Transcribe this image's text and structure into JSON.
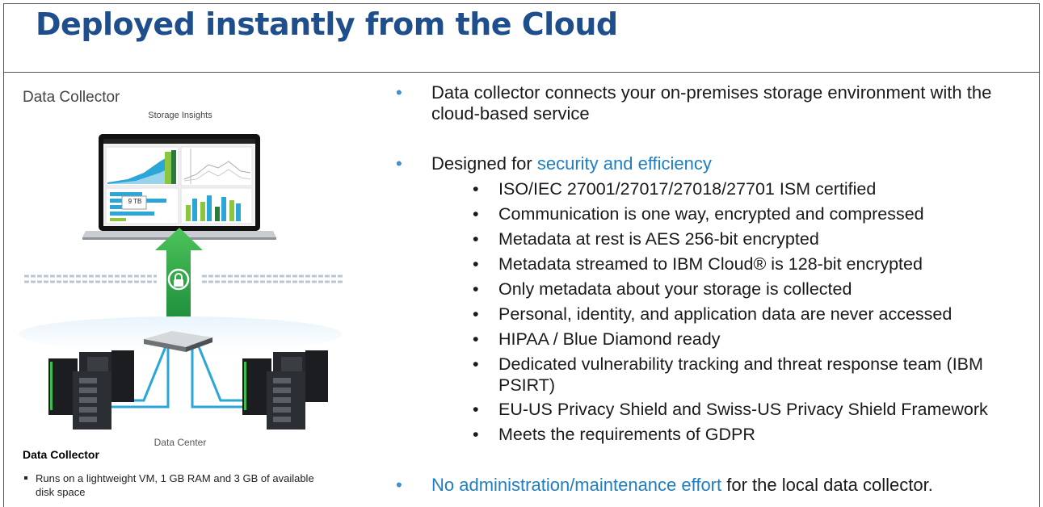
{
  "slide": {
    "title": "Deployed instantly from the Cloud"
  },
  "left_panel": {
    "heading": "Data Collector",
    "subheading": "Storage Insights",
    "screen_badge": "9 TB",
    "footer_label": "Data Center",
    "caption_title": "Data Collector",
    "caption_items": [
      "Runs on a lightweight VM, 1 GB RAM and 3 GB of available disk space"
    ]
  },
  "bullets": {
    "b1": "Data collector connects your on-premises storage environment with the cloud-based service",
    "b2_prefix": "Designed for ",
    "b2_accent": "security and efficiency",
    "sub": [
      "ISO/IEC 27001/27017/27018/27701 ISM certified",
      "Communication is one way, encrypted and compressed",
      "Metadata at rest is AES 256-bit encrypted",
      "Metadata streamed to IBM Cloud® is 128-bit encrypted",
      "Only metadata about your storage is collected",
      "Personal, identity, and application data are never accessed",
      "HIPAA / Blue Diamond ready",
      "Dedicated vulnerability tracking and threat response team (IBM PSIRT)",
      "EU-US Privacy Shield and Swiss-US Privacy Shield Framework",
      "Meets the requirements of GDPR"
    ],
    "b3_accent": "No administration/maintenance effort",
    "b3_suffix": " for the local data collector."
  },
  "colors": {
    "title": "#1f4e8c",
    "accent": "#1f7ec1",
    "bullet_dot": "#3e8ed0",
    "arrow": "#2faa4a"
  },
  "icons": {
    "bullet": "•",
    "lock": "lock-icon"
  }
}
